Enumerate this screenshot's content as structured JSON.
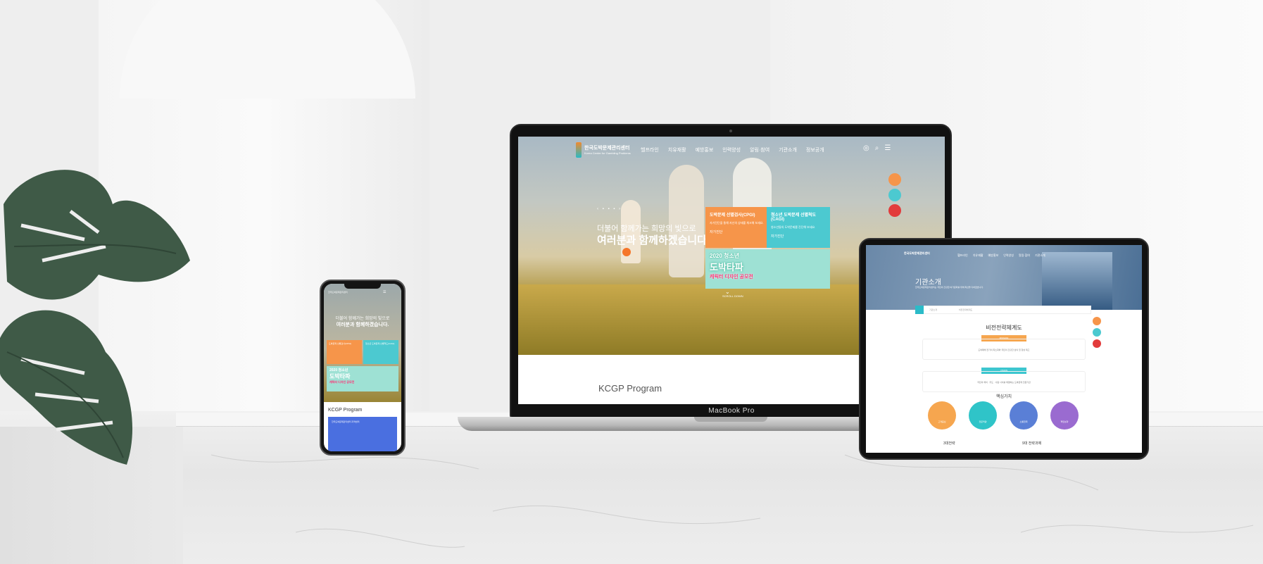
{
  "laptop": {
    "brand_label": "MacBook Pro",
    "logo_name": "한국도박문제관리센터",
    "logo_sub": "Korea Center for Gambling Problems",
    "nav": [
      "헬프라인",
      "치유재활",
      "예방홍보",
      "인력양성",
      "알림·참여",
      "기관소개",
      "정보공개"
    ],
    "hero_line1": "더불어 함께가는 희망의 빛으로",
    "hero_line2": "여러분과 함께하겠습니다.",
    "card_orange": {
      "title": "도박문제 선별검사(CPGI)",
      "body": "자가진단을 통해 자신의 상태를 체크해 보세요.",
      "more": "자가진단"
    },
    "card_cyan": {
      "title": "청소년 도박문제 선별척도(CAGI)",
      "body": "청소년들의 도박문제를 진단해 보세요.",
      "more": "자가진단"
    },
    "banner": {
      "year": "2020 청소년",
      "big": "도박타파",
      "sub": "캐릭터 디자인 공모전"
    },
    "scroll_label": "SCROLL DOWN",
    "program_heading": "KCGP Program",
    "quick_colors": [
      "#f6954a",
      "#4cc9d0",
      "#e23b3b"
    ]
  },
  "tablet": {
    "logo_name": "한국도박문제관리센터",
    "nav": [
      "헬프라인",
      "치유재활",
      "예방홍보",
      "인력양성",
      "알림·참여",
      "기관소개"
    ],
    "page_title": "기관소개",
    "page_desc": "한국도박문제관리센터는 국민의 건강한 여가문화를 위해 최선을 다하겠습니다.",
    "crumb": [
      "기관소개",
      "비전전략체계도"
    ],
    "heading": "비전전략체계도",
    "mission_label": "MISSION",
    "mission_text": "도박폐해 전가의 최소화와 국민의 건강한 삶의 질 향상 제고",
    "vision_label": "VISION",
    "vision_text": "국민의 해의 · 주도 · 사람 사이를 해결하는 도박문제 전문기관",
    "core_title": "핵심가치",
    "values": [
      {
        "label": "고객중심",
        "color": "#f6a64f"
      },
      {
        "label": "전문역량",
        "color": "#2fc4c8"
      },
      {
        "label": "소통협력",
        "color": "#5a7fd6"
      },
      {
        "label": "책임성과",
        "color": "#9a6bd0"
      }
    ],
    "strategy_left": "3대전략",
    "strategy_right": "9대 전략과제"
  },
  "phone": {
    "logo_name": "한국도박문제관리센터",
    "hero_line1": "더불어 함께가는 희망의 빛으로",
    "hero_line2": "여러분과 함께하겠습니다.",
    "card_orange": "도박문제 선별검사(CPGI)",
    "card_cyan": "청소년 도박문제 선별척도(CAGI)",
    "banner": {
      "year": "2020 청소년",
      "big": "도박타파",
      "sub": "캐릭터 디자인 공모전"
    },
    "program_heading": "KCGP Program",
    "program_card": "한국도박문제관리센터 지역센터"
  }
}
